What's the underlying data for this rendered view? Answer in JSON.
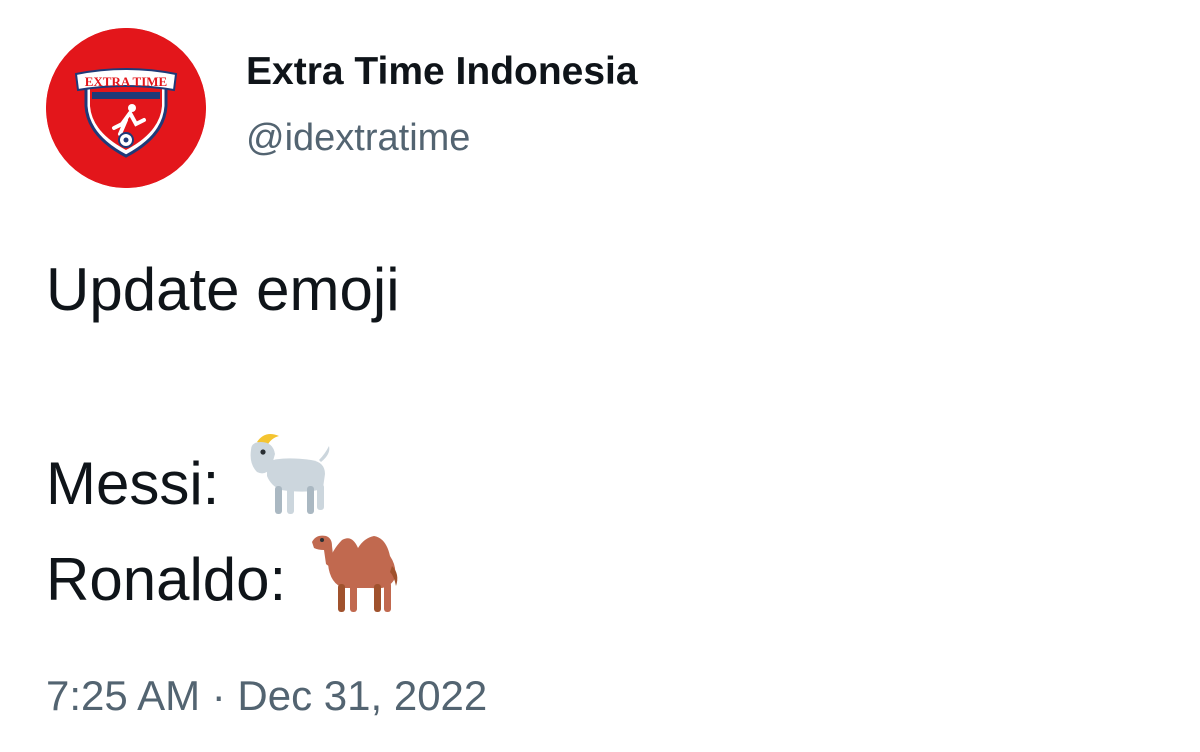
{
  "tweet": {
    "display_name": "Extra Time Indonesia",
    "handle": "@idextratime",
    "avatar": {
      "logo_text": "EXTRA TIME",
      "bg_color": "#e3161b"
    },
    "line1": "Update emoji",
    "line2": "Messi:",
    "line2_emoji": "goat-emoji",
    "line3": "Ronaldo:",
    "line3_emoji": "camel-emoji",
    "timestamp": "7:25 AM · Dec 31, 2022"
  },
  "colors": {
    "text_primary": "#0f1419",
    "text_secondary": "#536471",
    "avatar_red": "#e3161b"
  }
}
